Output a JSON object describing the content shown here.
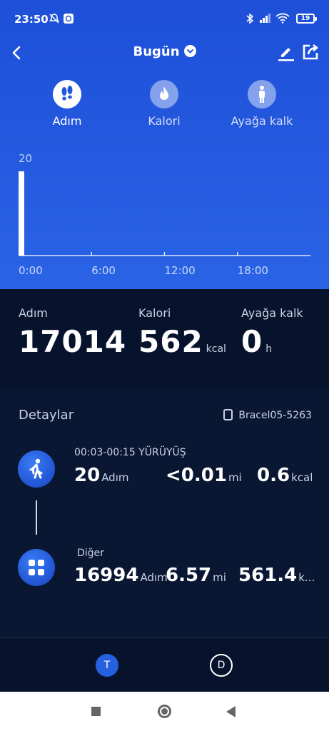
{
  "status_bar": {
    "time": "23:50",
    "battery": "19"
  },
  "header": {
    "title": "Bugün"
  },
  "metric_tabs": [
    {
      "label": "Adım",
      "icon": "footprints-icon",
      "active": true
    },
    {
      "label": "Kalori",
      "icon": "flame-icon",
      "active": false
    },
    {
      "label": "Ayağa kalk",
      "icon": "standing-person-icon",
      "active": false
    }
  ],
  "chart_data": {
    "type": "bar",
    "x_tick_labels": [
      "0:00",
      "6:00",
      "12:00",
      "18:00"
    ],
    "y_tick_label": "20",
    "ylim": [
      0,
      20
    ],
    "xlim_hours": [
      0,
      24
    ],
    "bars": [
      {
        "hour": 0.0,
        "value": 20
      }
    ],
    "bar_color": "#ffffff",
    "grid": false
  },
  "summary": [
    {
      "label": "Adım",
      "value": "17014",
      "unit": ""
    },
    {
      "label": "Kalori",
      "value": "562",
      "unit": "kcal"
    },
    {
      "label": "Ayağa kalk",
      "value": "0",
      "unit": "h"
    }
  ],
  "details": {
    "title": "Detaylar",
    "device": "Bracel05-5263",
    "records": [
      {
        "time": "00:03-00:15  YÜRÜYÜŞ",
        "icon": "walking-person-icon",
        "steps": "20",
        "steps_unit": "Adım",
        "distance": "<0.01",
        "distance_unit": "mi",
        "calories": "0.6",
        "calories_unit": "kcal"
      },
      {
        "time": "Diğer",
        "icon": "apps-grid-icon",
        "steps": "16994",
        "steps_unit": "Adım",
        "distance": "6.57",
        "distance_unit": "mi",
        "calories": "561.4",
        "calories_unit": "k..."
      }
    ]
  },
  "bottom_tabs": [
    {
      "label": "T",
      "active": true
    },
    {
      "label": "D",
      "active": false
    }
  ],
  "colors": {
    "accent": "#2560df",
    "background": "#0a1733",
    "hero": "#2358de"
  }
}
